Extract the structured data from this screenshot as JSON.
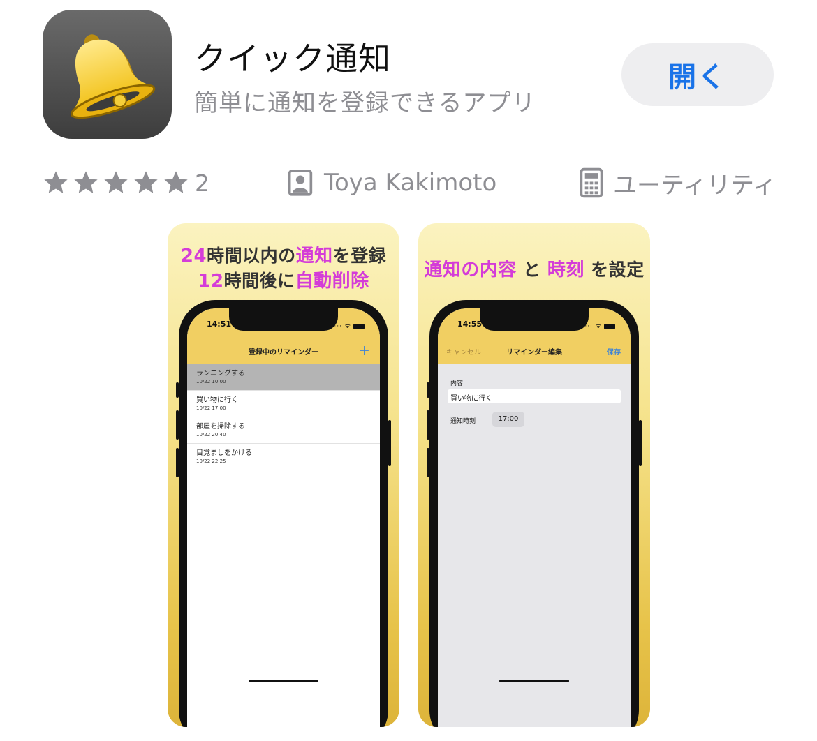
{
  "app": {
    "icon_name": "bell-icon",
    "title": "クイック通知",
    "subtitle": "簡単に通知を登録できるアプリ",
    "open_label": "開く",
    "accent_color": "#1a73e8"
  },
  "info": {
    "rating_stars": 5,
    "rating_count": "2",
    "developer": "Toya Kakimoto",
    "category": "ユーティリティ"
  },
  "screenshot1": {
    "line1_a": "24",
    "line1_b": "時間以内の",
    "line1_c": "通知",
    "line1_d": "を登録",
    "line2_a": "12",
    "line2_b": "時間後に",
    "line2_c": "自動削除",
    "status_time": "14:51",
    "nav_title": "登録中のリマインダー",
    "nav_plus": "+",
    "reminders": [
      {
        "title": "ランニングする",
        "date": "10/22 10:00"
      },
      {
        "title": "買い物に行く",
        "date": "10/22 17:00"
      },
      {
        "title": "部屋を掃除する",
        "date": "10/22 20:40"
      },
      {
        "title": "目覚ましをかける",
        "date": "10/22 22:25"
      }
    ]
  },
  "screenshot2": {
    "hl_a": "通知の内容",
    "hl_b": " と ",
    "hl_c": "時刻",
    "hl_d": " を設定",
    "status_time": "14:55",
    "nav_cancel": "キャンセル",
    "nav_title": "リマインダー編集",
    "nav_save": "保存",
    "content_label": "内容",
    "content_value": "買い物に行く",
    "time_label": "通知時刻",
    "time_value": "17:00"
  }
}
